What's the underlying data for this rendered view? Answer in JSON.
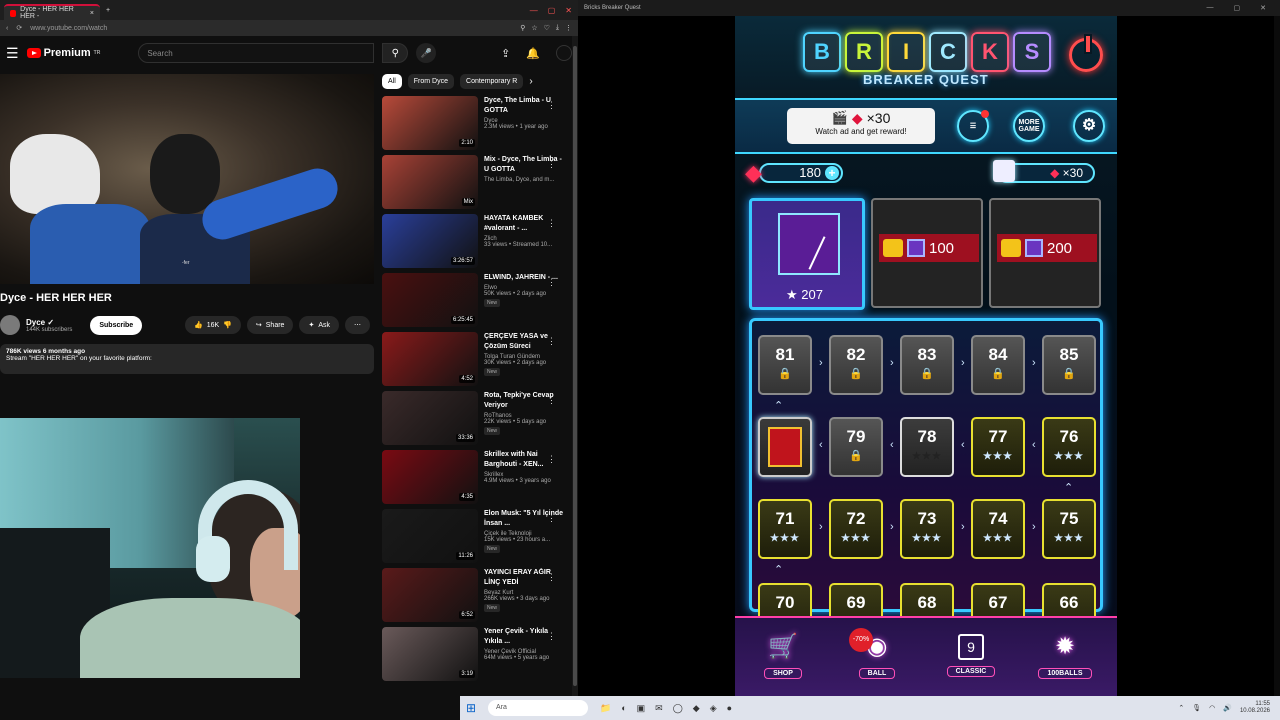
{
  "youtube": {
    "tab_title": "Dyce - HER HER HER -",
    "url": "www.youtube.com/watch",
    "logo_text": "Premium",
    "logo_sup": "TR",
    "search_placeholder": "Search",
    "video_caption": "-fer",
    "video_title": "Dyce - HER HER HER",
    "channel_name": "Dyce",
    "channel_subs": "144K subscribers",
    "subscribe_label": "Subscribe",
    "likes": "16K",
    "share_label": "Share",
    "ask_label": "Ask",
    "desc_stats": "786K views  6 months ago",
    "desc_text": "Stream \"HER HER HER\" on your favorite platform:",
    "chips": [
      "All",
      "From Dyce",
      "Contemporary R"
    ],
    "recs": [
      {
        "title": "Dyce, The Limba - U GOTTA",
        "channel": "Dyce",
        "stats": "2.3M views • 1 year ago",
        "dur": "2:10",
        "new": "",
        "color": "#b84a3a"
      },
      {
        "title": "Mix - Dyce, The Limba - U GOTTA",
        "channel": "The Limba, Dyce, and m...",
        "stats": "",
        "dur": "Mix",
        "new": "",
        "color": "#a84236"
      },
      {
        "title": "HAYATA KAMBEK #valorant  - ...",
        "channel": "Zlich",
        "stats": "33 views • Streamed 10...",
        "dur": "3:26:57",
        "new": "",
        "color": "#2a3f9a"
      },
      {
        "title": "ELWIND, JAHREIN - ...",
        "channel": "Elwo",
        "stats": "50K views • 2 days ago",
        "dur": "6:25:45",
        "new": "New",
        "color": "#4a1010"
      },
      {
        "title": "ÇERÇEVE YASA ve Çözüm Süreci",
        "channel": "Tolga Turan Gündem",
        "stats": "30K views • 2 days ago",
        "dur": "4:52",
        "new": "New",
        "color": "#8a1a1a"
      },
      {
        "title": "Rota, Tepki'ye Cevap Veriyor",
        "channel": "RoThanos",
        "stats": "22K views • 5 days ago",
        "dur": "33:36",
        "new": "New",
        "color": "#3a2a2a"
      },
      {
        "title": "Skrillex with Nai Barghouti - XEN...",
        "channel": "Skrillex",
        "stats": "4.9M views • 3 years ago",
        "dur": "4:35",
        "new": "",
        "color": "#7a0a12"
      },
      {
        "title": "Elon Musk: \"5 Yıl İçinde İnsan ...",
        "channel": "Çiçek ile Teknoloji",
        "stats": "15K views • 23 hours a...",
        "dur": "11:26",
        "new": "New",
        "color": "#1a1a1a"
      },
      {
        "title": "YAYINCI ERAY AĞIR LİNÇ YEDİ",
        "channel": "Beyaz Kurt",
        "stats": "266K views • 3 days ago",
        "dur": "6:52",
        "new": "New",
        "color": "#5a1a1a"
      },
      {
        "title": "Yener Çevik - Yıkıla Yıkıla ...",
        "channel": "Yener Çevik Official",
        "stats": "64M views • 5 years ago",
        "dur": "3:19",
        "new": "",
        "color": "#6a5a5a"
      }
    ]
  },
  "game": {
    "window_title": "Bricks Breaker Quest",
    "logo_letters": [
      "B",
      "R",
      "I",
      "C",
      "K",
      "S"
    ],
    "logo_colors": [
      "#4fd4ff",
      "#c8f53a",
      "#ffd93a",
      "#9fe9ff",
      "#ff5470",
      "#b58cff"
    ],
    "subtitle": "BREAKER QUEST",
    "ad_count": "×30",
    "ad_text": "Watch ad and get reward!",
    "more_game": "MORE GAME",
    "gems": "180",
    "gift_gems": "×30",
    "ball_selected_stars": "207",
    "ball_price_1": "100",
    "ball_price_2": "200",
    "levels": {
      "row1": [
        "81",
        "82",
        "83",
        "84",
        "85"
      ],
      "row2": [
        "",
        "79",
        "78",
        "77",
        "76"
      ],
      "row3": [
        "71",
        "72",
        "73",
        "74",
        "75"
      ],
      "row4": [
        "70",
        "69",
        "68",
        "67",
        "66"
      ]
    },
    "stars": "★★★",
    "bottom": {
      "shop": "SHOP",
      "ball": "BALL",
      "classic": "CLASSIC",
      "classic_num": "9",
      "balls100": "100BALLS",
      "sale": "-70%"
    }
  },
  "taskbar": {
    "search": "Ara",
    "time": "11:55",
    "date": "10.08.2026"
  }
}
